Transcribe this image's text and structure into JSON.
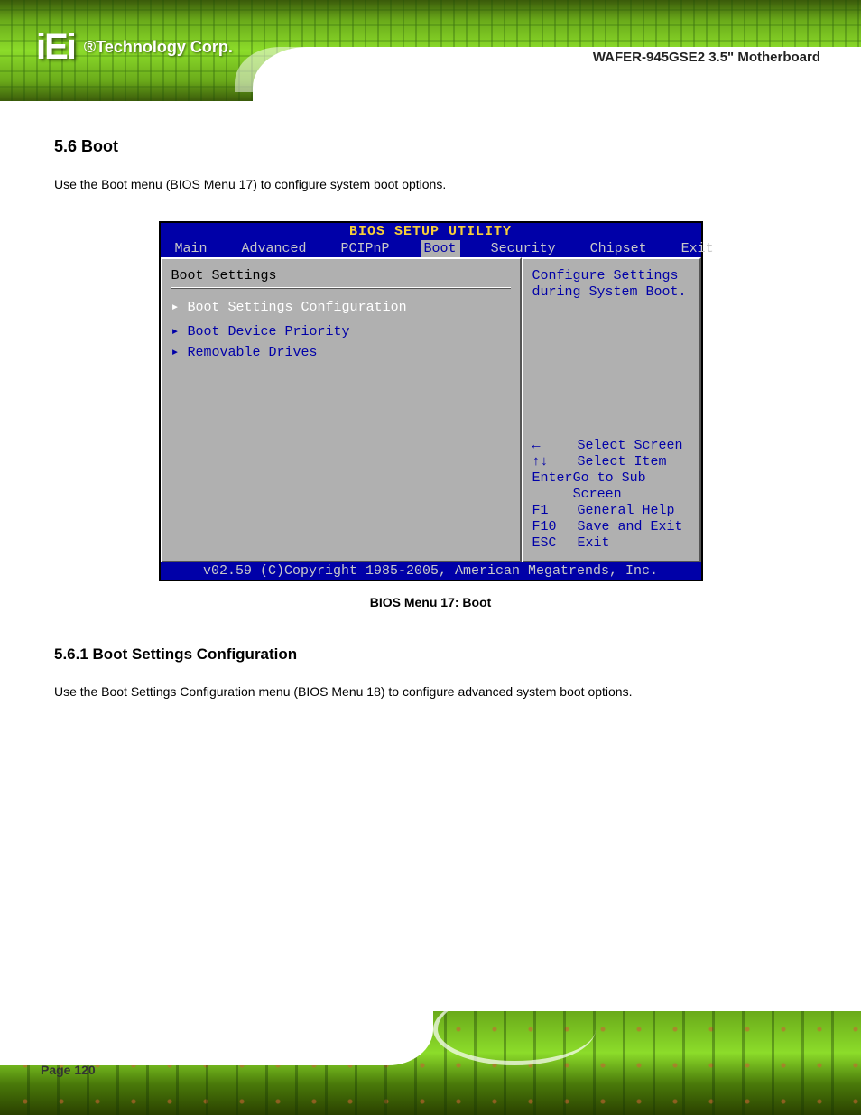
{
  "header": {
    "logo_text": "iEi",
    "logo_tag": "®Technology Corp.",
    "product": "WAFER-945GSE2 3.5\" Motherboard"
  },
  "section": {
    "heading": "5.6 Boot",
    "intro": "Use the Boot menu (BIOS Menu 17) to configure system boot options."
  },
  "bios": {
    "title": "BIOS SETUP UTILITY",
    "tabs": [
      "Main",
      "Advanced",
      "PCIPnP",
      "Boot",
      "Security",
      "Chipset",
      "Exit"
    ],
    "active_tab": "Boot",
    "panel_title": "Boot Settings",
    "items": [
      "▸ Boot Settings Configuration",
      "",
      "▸ Boot Device Priority",
      "▸ Removable Drives"
    ],
    "help_top": "Configure Settings\nduring System Boot.",
    "keys": [
      {
        "k": "←",
        "v": "Select Screen"
      },
      {
        "k": "↑↓",
        "v": "Select Item"
      },
      {
        "k": "Enter",
        "v": "Go to Sub Screen"
      },
      {
        "k": "F1",
        "v": "General Help"
      },
      {
        "k": "F10",
        "v": "Save and Exit"
      },
      {
        "k": "ESC",
        "v": "Exit"
      }
    ],
    "footer": "v02.59 (C)Copyright 1985-2005, American Megatrends, Inc."
  },
  "caption": "BIOS Menu 17: Boot",
  "subsection": {
    "heading": "5.6.1 Boot Settings Configuration",
    "intro": "Use the Boot Settings Configuration menu (BIOS Menu 18) to configure advanced system boot options."
  },
  "page_number": "Page 120"
}
